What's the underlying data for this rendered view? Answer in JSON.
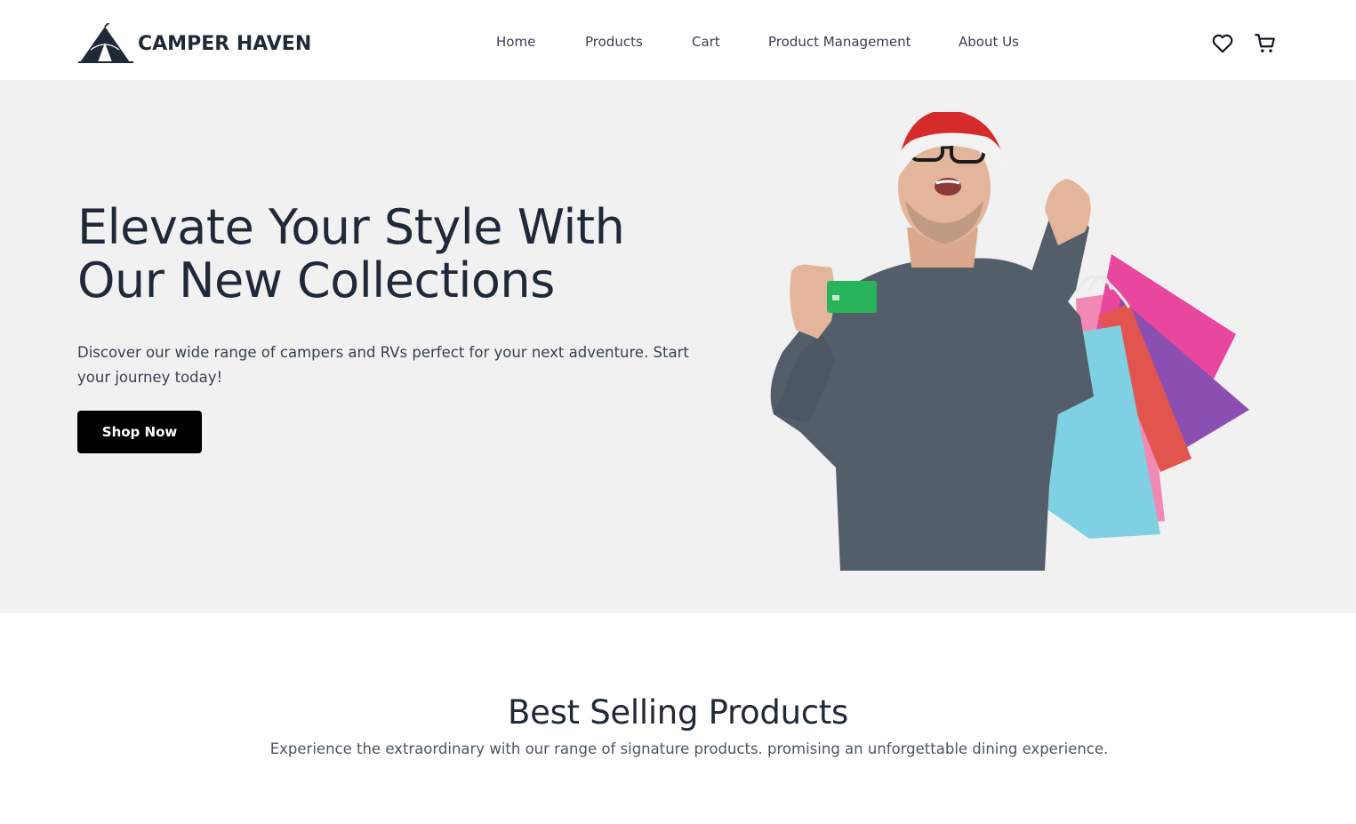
{
  "brand": {
    "name": "CAMPER HAVEN",
    "logo_icon": "tent-icon"
  },
  "nav": {
    "items": [
      {
        "label": "Home"
      },
      {
        "label": "Products"
      },
      {
        "label": "Cart"
      },
      {
        "label": "Product Management"
      },
      {
        "label": "About Us"
      }
    ]
  },
  "header_actions": {
    "wishlist_icon": "heart-icon",
    "cart_icon": "shopping-cart-icon"
  },
  "hero": {
    "title_line1": "Elevate Your Style With",
    "title_line2": "Our New Collections",
    "description": "Discover our wide range of campers and RVs perfect for your next adventure. Start your journey today!",
    "cta_label": "Shop Now",
    "background_color": "#f1f1f1"
  },
  "best_selling": {
    "title": "Best Selling Products",
    "subtitle": "Experience the extraordinary with our range of signature products. promising an unforgettable dining experience."
  },
  "colors": {
    "text_dark": "#1f2937",
    "button_bg": "#000000",
    "button_text": "#ffffff"
  }
}
